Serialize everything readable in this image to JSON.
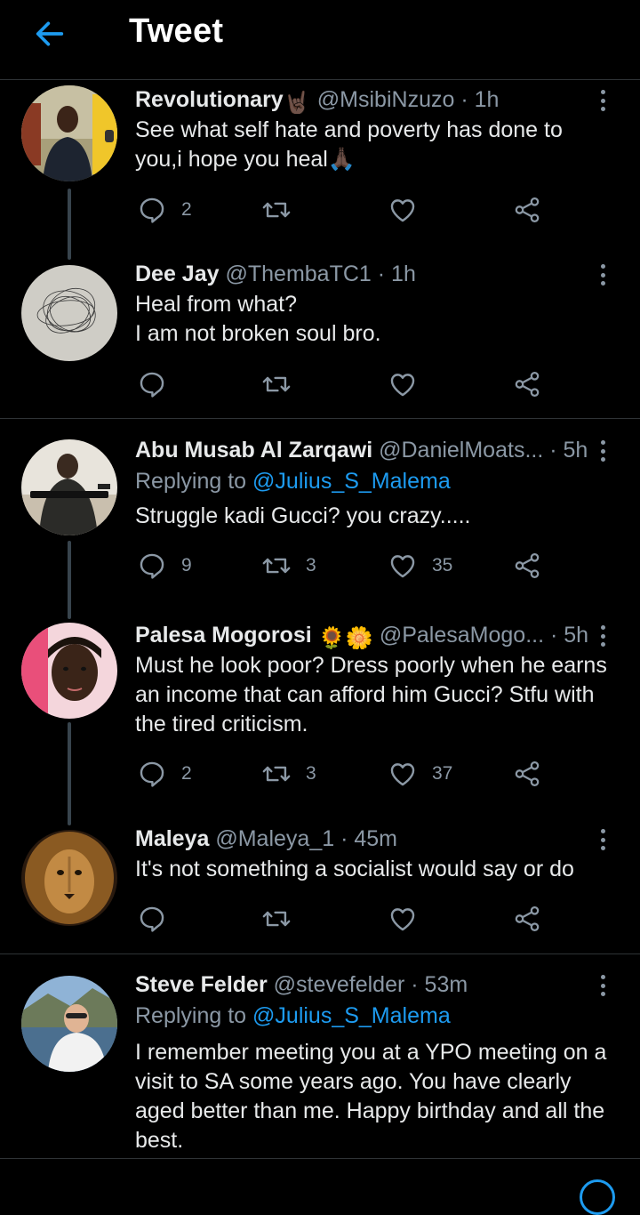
{
  "header": {
    "title": "Tweet",
    "back_icon": "arrow-left-icon"
  },
  "colors": {
    "background": "#000000",
    "accent": "#1d9bf0",
    "muted": "#8b98a5",
    "text": "#e7e9ea"
  },
  "replies": [
    {
      "name": "Revolutionary",
      "name_emoji": "🤘🏿",
      "handle": "@MsibiNzuzo",
      "time": "1h",
      "text": "See what self hate and poverty has done to you,i hope you heal🙏🏿",
      "reply_count": "2",
      "retweet_count": "",
      "like_count": ""
    },
    {
      "name": "Dee Jay",
      "handle": "@ThembaTC1",
      "time": "1h",
      "text_lines": [
        "Heal from what?",
        "I am not broken soul bro."
      ],
      "reply_count": "",
      "retweet_count": "",
      "like_count": ""
    },
    {
      "name": "Abu Musab Al Zarqawi",
      "handle": "@DanielMoats...",
      "time": "5h",
      "replying_prefix": "Replying to",
      "replying_to": "@Julius_S_Malema",
      "text": "Struggle kadi Gucci? you crazy.....",
      "reply_count": "9",
      "retweet_count": "3",
      "like_count": "35"
    },
    {
      "name": "Palesa Mogorosi",
      "name_emoji": "🌻🌼",
      "handle": "@PalesaMogo...",
      "time": "5h",
      "text": "Must he look poor? Dress poorly when he earns an income that can afford him Gucci? Stfu with the tired criticism.",
      "reply_count": "2",
      "retweet_count": "3",
      "like_count": "37"
    },
    {
      "name": "Maleya",
      "handle": "@Maleya_1",
      "time": "45m",
      "text": "It's not something a socialist would say or do",
      "reply_count": "",
      "retweet_count": "",
      "like_count": ""
    },
    {
      "name": "Steve Felder",
      "handle": "@stevefelder",
      "time": "53m",
      "replying_prefix": "Replying to",
      "replying_to": "@Julius_S_Malema",
      "text": "I remember meeting you at a YPO meeting on a visit to SA some years ago. You have clearly aged better than me. Happy birthday and all the best."
    }
  ],
  "separator": "·"
}
